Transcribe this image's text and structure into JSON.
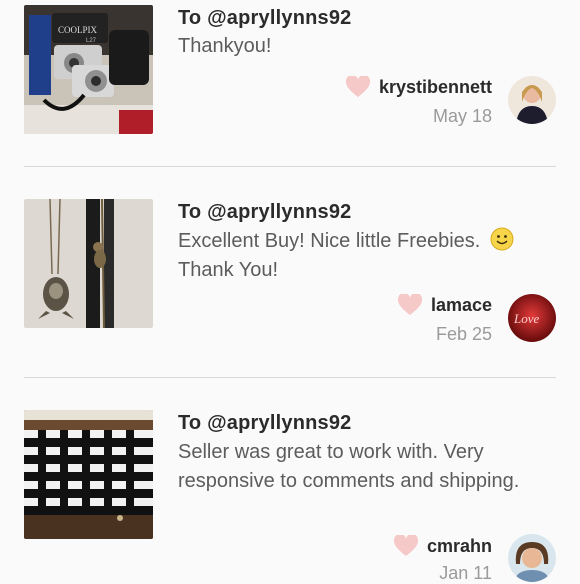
{
  "reviews": [
    {
      "to": "To @apryllynns92",
      "message": "Thankyou!",
      "username": "krystibennett",
      "date": "May 18",
      "icons": {
        "like": "heart-icon",
        "thumb": "camera-photo",
        "avatar": "user-avatar"
      }
    },
    {
      "to": "To @apryllynns92",
      "message": "Excellent Buy! Nice little Freebies.",
      "message2": "Thank You!",
      "username": "lamace",
      "date": "Feb 25",
      "icons": {
        "like": "heart-icon",
        "emoji": "smiley-icon",
        "thumb": "necklace-photo",
        "avatar": "love-avatar"
      }
    },
    {
      "to": "To @apryllynns92",
      "message": "Seller was great to work with. Very responsive to comments and shipping.",
      "username": "cmrahn",
      "date": "Jan 11",
      "icons": {
        "like": "heart-icon",
        "thumb": "striped-dress-photo",
        "avatar": "user-avatar"
      }
    }
  ],
  "avatar_text": {
    "love": "Love"
  },
  "thumb_text": {
    "camera": "COOLPIX",
    "camera_model": "L27"
  },
  "colors": {
    "heart": "#f6c9c9",
    "divider": "#d9d9d9",
    "date": "#9a9a9a"
  }
}
